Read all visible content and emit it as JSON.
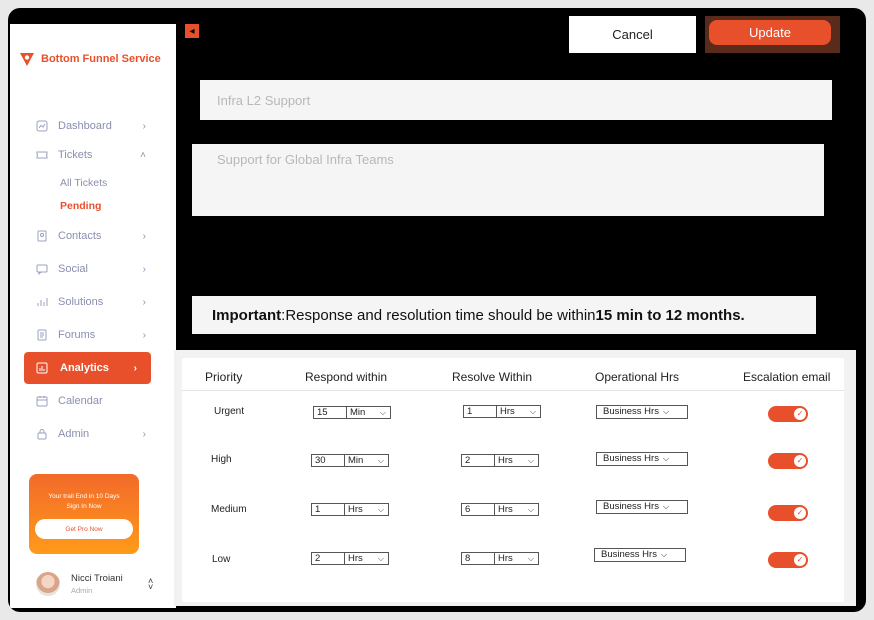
{
  "brand": {
    "name": "Bottom Funnel Service"
  },
  "nav": {
    "items": [
      {
        "label": "Dashboard",
        "icon": "dashboard-icon"
      },
      {
        "label": "Tickets",
        "icon": "ticket-icon"
      },
      {
        "label": "Contacts",
        "icon": "contacts-icon"
      },
      {
        "label": "Social",
        "icon": "social-icon"
      },
      {
        "label": "Solutions",
        "icon": "solutions-icon"
      },
      {
        "label": "Forums",
        "icon": "forums-icon"
      },
      {
        "label": "Analytics",
        "icon": "analytics-icon",
        "active": true
      },
      {
        "label": "Calendar",
        "icon": "calendar-icon"
      },
      {
        "label": "Admin",
        "icon": "lock-icon"
      }
    ],
    "sub_items": [
      {
        "label": "All Tickets"
      },
      {
        "label": "Pending",
        "active": true
      }
    ]
  },
  "promo": {
    "line1": "Your trail End in 10 Days",
    "line2": "Sign In Now",
    "button": "Get Pro Now"
  },
  "user": {
    "name": "Nicci Troiani",
    "role": "Admin"
  },
  "toolbar": {
    "cancel": "Cancel",
    "update": "Update"
  },
  "form": {
    "title_placeholder": "Infra L2 Support",
    "description_placeholder": "Support for Global Infra Teams"
  },
  "notice": {
    "label": "Important",
    "text": ":Response and resolution time should be within ",
    "emphasis": "15 min to 12 months."
  },
  "sla_table": {
    "headers": [
      "Priority",
      "Respond within",
      "Resolve Within",
      "Operational Hrs",
      "Escalation email"
    ],
    "rows": [
      {
        "priority": "Urgent",
        "respond_value": "15",
        "respond_unit": "Min",
        "resolve_value": "1",
        "resolve_unit": "Hrs",
        "operational": "Business Hrs",
        "escalation": true
      },
      {
        "priority": "High",
        "respond_value": "30",
        "respond_unit": "Min",
        "resolve_value": "2",
        "resolve_unit": "Hrs",
        "operational": "Business Hrs",
        "escalation": true
      },
      {
        "priority": "Medium",
        "respond_value": "1",
        "respond_unit": "Hrs",
        "resolve_value": "6",
        "resolve_unit": "Hrs",
        "operational": "Business Hrs",
        "escalation": true
      },
      {
        "priority": "Low",
        "respond_value": "2",
        "respond_unit": "Hrs",
        "resolve_value": "8",
        "resolve_unit": "Hrs",
        "operational": "Business Hrs",
        "escalation": true
      }
    ]
  },
  "colors": {
    "accent": "#e8502c",
    "muted": "#8a8fb0"
  }
}
